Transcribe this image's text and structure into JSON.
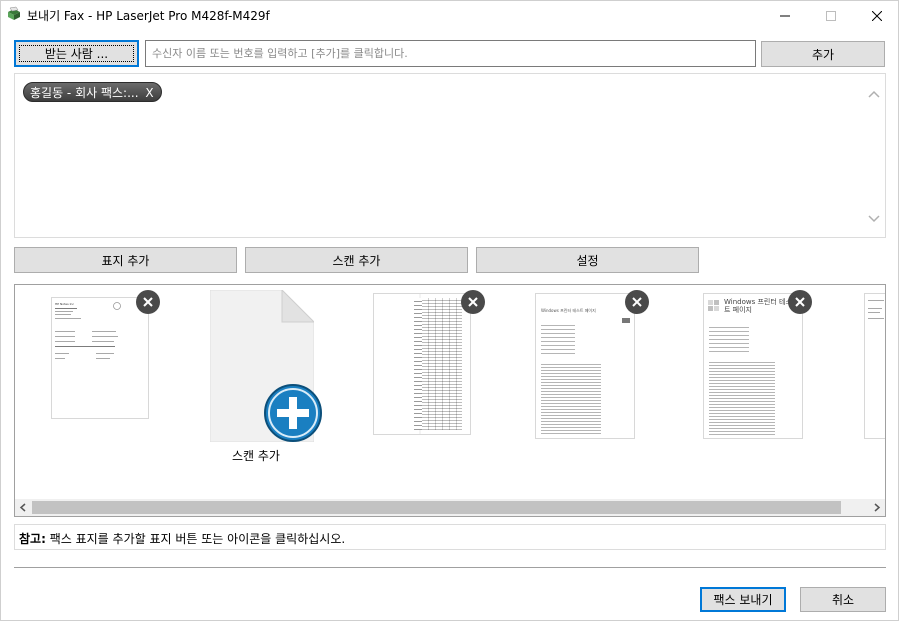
{
  "window": {
    "title": "보내기 Fax - HP LaserJet Pro M428f-M429f",
    "minimize_icon": "minimize-icon",
    "maximize_icon": "maximize-icon",
    "close_icon": "close-icon"
  },
  "recipients": {
    "button_label": "받는 사람 ...",
    "input_placeholder": "수신자 이름 또는 번호를 입력하고 [추가]를 클릭합니다.",
    "input_value": "",
    "add_label": "추가",
    "chips": [
      {
        "label": "홍길동 - 회사 팩스:...",
        "remove": "X"
      }
    ]
  },
  "actions": {
    "add_cover_label": "표지 추가",
    "add_scan_label": "스캔 추가",
    "settings_label": "설정"
  },
  "thumbnails": {
    "add_scan_caption": "스캔 추가",
    "items": [
      {
        "type": "cover-page",
        "header": "HP Notes Inc"
      },
      {
        "type": "add-scan"
      },
      {
        "type": "table-document"
      },
      {
        "type": "windows-test-page",
        "header": "Windows 프린터 테스트 페이지"
      },
      {
        "type": "windows-test-page",
        "header": "Windows 프린터 테스트 페이지"
      },
      {
        "type": "partial-document"
      }
    ]
  },
  "note": {
    "prefix": "참고:",
    "text": " 팩스 표지를 추가할 표지 버튼 또는 아이콘을 클릭하십시오."
  },
  "footer": {
    "send_label": "팩스 보내기",
    "cancel_label": "취소"
  },
  "colors": {
    "focus_border": "#0078d7",
    "button_bg": "#e1e1e1",
    "add_icon": "#1a7fc1"
  }
}
